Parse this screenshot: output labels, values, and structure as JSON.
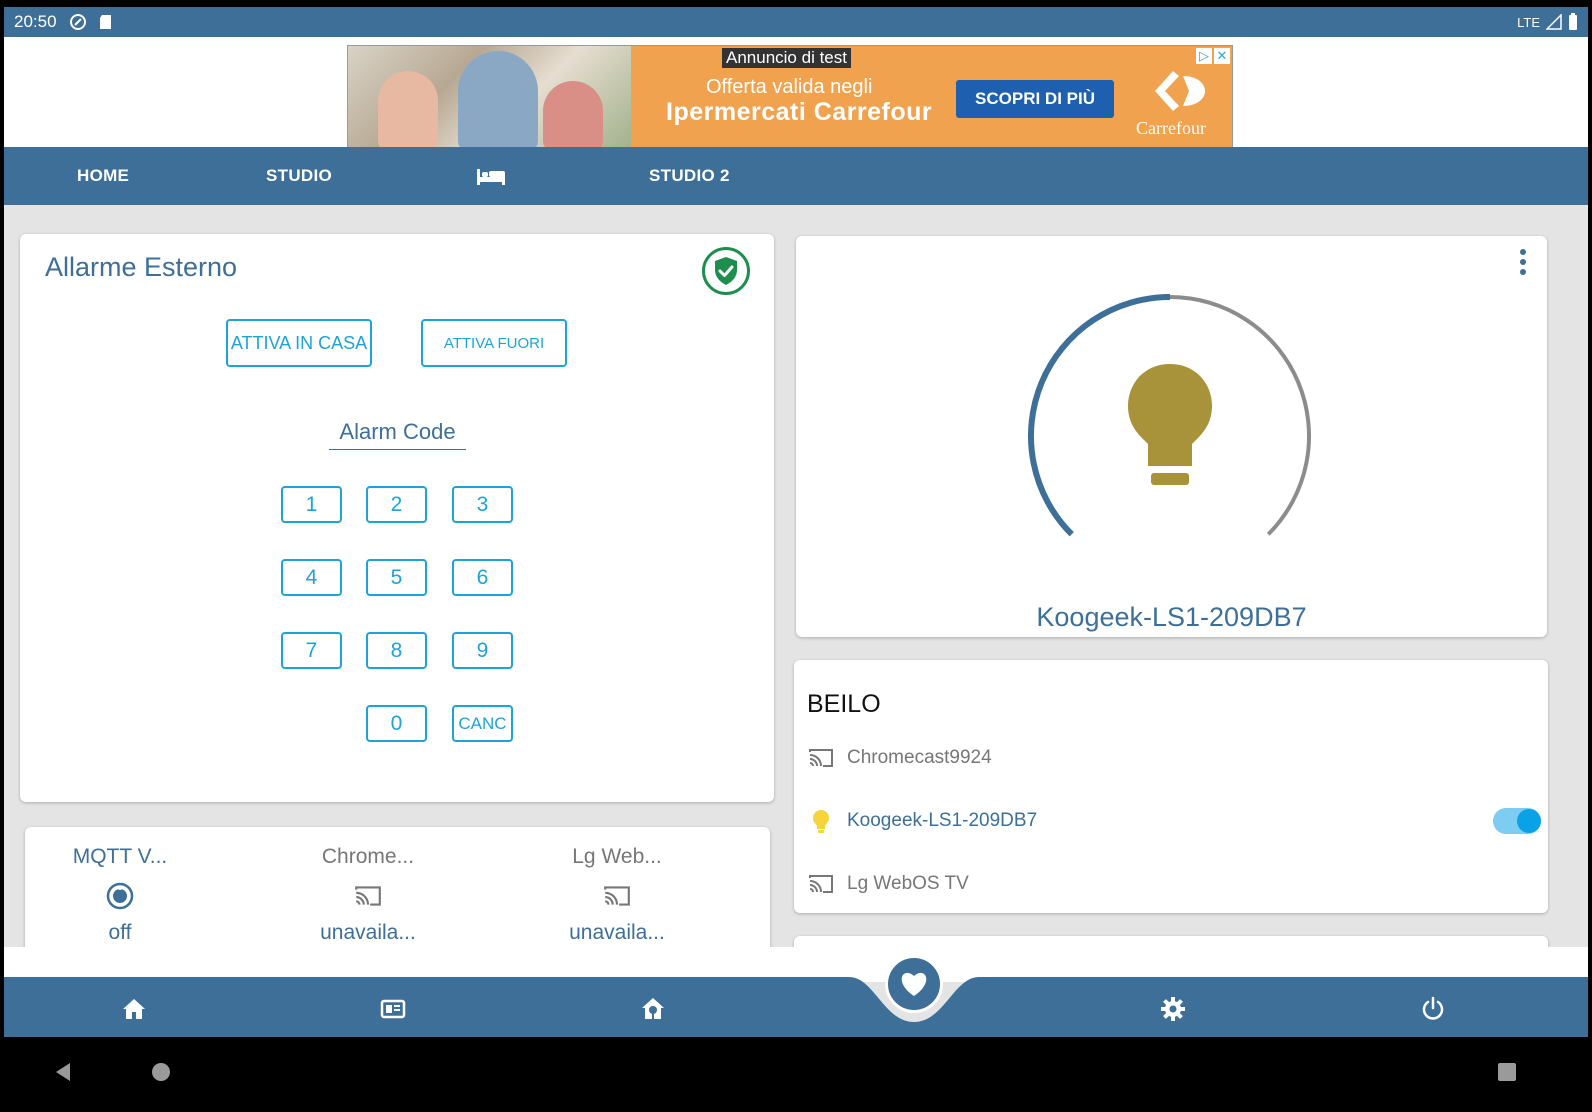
{
  "status_bar": {
    "time": "20:50",
    "network": "LTE",
    "icons": [
      "sync-icon",
      "sd-card-icon",
      "signal-icon",
      "battery-icon"
    ]
  },
  "ad": {
    "tag": "Annuncio di test",
    "line1": "Offerta valida negli",
    "line2": "Ipermercati Carrefour",
    "cta": "SCOPRI DI PIÙ",
    "brand": "Carrefour"
  },
  "tabs": {
    "home": "HOME",
    "studio": "STUDIO",
    "bedroom_icon": "bed-icon",
    "studio2": "STUDIO 2"
  },
  "alarm": {
    "title": "Allarme Esterno",
    "arm_home": "ATTIVA IN CASA",
    "arm_away": "ATTIVA FUORI",
    "code_label": "Alarm Code",
    "keys": [
      "1",
      "2",
      "3",
      "4",
      "5",
      "6",
      "7",
      "8",
      "9",
      "0",
      "CANC"
    ],
    "status_icon": "shield-check-icon",
    "status_color": "#1e8e4f"
  },
  "light": {
    "name": "Koogeek-LS1-209DB7",
    "brightness_percent": 50,
    "bulb_color": "#a8933a",
    "arc_color": "#3d6f98"
  },
  "beilo": {
    "title": "BEILO",
    "entities": [
      {
        "name": "Chromecast9924",
        "icon": "cast-icon",
        "state": "unavailable"
      },
      {
        "name": "Koogeek-LS1-209DB7",
        "icon": "lightbulb-icon",
        "state": "on"
      },
      {
        "name": "Lg WebOS TV",
        "icon": "cast-icon",
        "state": "unavailable"
      }
    ]
  },
  "mini": {
    "items": [
      {
        "name": "MQTT V...",
        "state": "off",
        "icon": "vacuum-icon"
      },
      {
        "name": "Chrome...",
        "state": "unavaila...",
        "icon": "cast-icon"
      },
      {
        "name": "Lg Web...",
        "state": "unavaila...",
        "icon": "cast-icon"
      }
    ]
  },
  "bottom_nav": {
    "items": [
      "home-icon",
      "dashboard-icon",
      "home-flower-icon",
      "heart-icon",
      "gear-icon",
      "power-icon"
    ]
  },
  "colors": {
    "primary": "#3d6f98",
    "accent": "#1ea3d9",
    "background": "#e4e4e4"
  }
}
